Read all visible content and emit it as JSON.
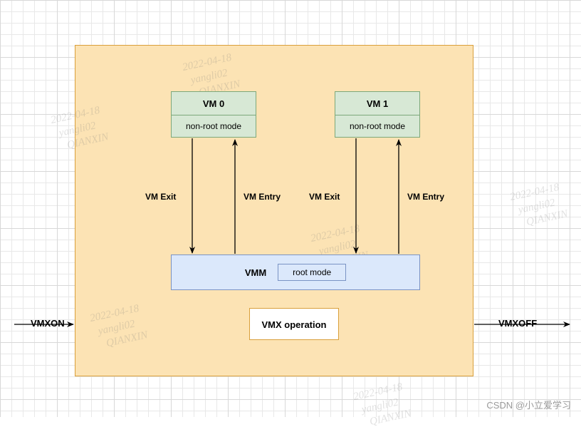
{
  "diagram": {
    "main_container": "",
    "vm0": {
      "title": "VM 0",
      "mode": "non-root mode"
    },
    "vm1": {
      "title": "VM 1",
      "mode": "non-root mode"
    },
    "vmm": {
      "label": "VMM",
      "mode": "root mode"
    },
    "vmx_op": "VMX operation",
    "arrows": {
      "vm0_exit": "VM Exit",
      "vm0_entry": "VM Entry",
      "vm1_exit": "VM Exit",
      "vm1_entry": "VM Entry",
      "vmxon": "VMXON",
      "vmxoff": "VMXOFF"
    }
  },
  "watermark": {
    "line1": "2022-04-18",
    "line2": "yangli02",
    "line3": "QIANXIN"
  },
  "credit": "CSDN @小立爱学习"
}
